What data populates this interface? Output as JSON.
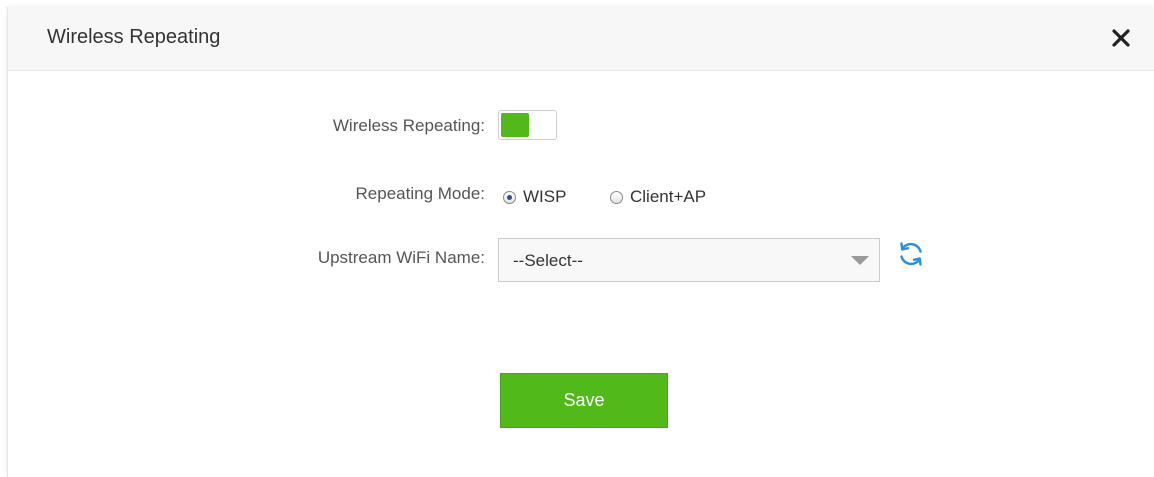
{
  "dialog": {
    "title": "Wireless Repeating",
    "close_icon": "close-icon"
  },
  "form": {
    "wireless_repeating": {
      "label": "Wireless Repeating:",
      "enabled": true,
      "accent_color": "#52b91b"
    },
    "repeating_mode": {
      "label": "Repeating Mode:",
      "options": [
        {
          "label": "WISP",
          "selected": true
        },
        {
          "label": "Client+AP",
          "selected": false
        }
      ]
    },
    "upstream_wifi": {
      "label": "Upstream WiFi Name:",
      "selected_value": "--Select--",
      "refresh_icon": "refresh-icon",
      "refresh_color": "#2a8fe0"
    }
  },
  "actions": {
    "save_label": "Save",
    "save_color": "#52b91b"
  }
}
